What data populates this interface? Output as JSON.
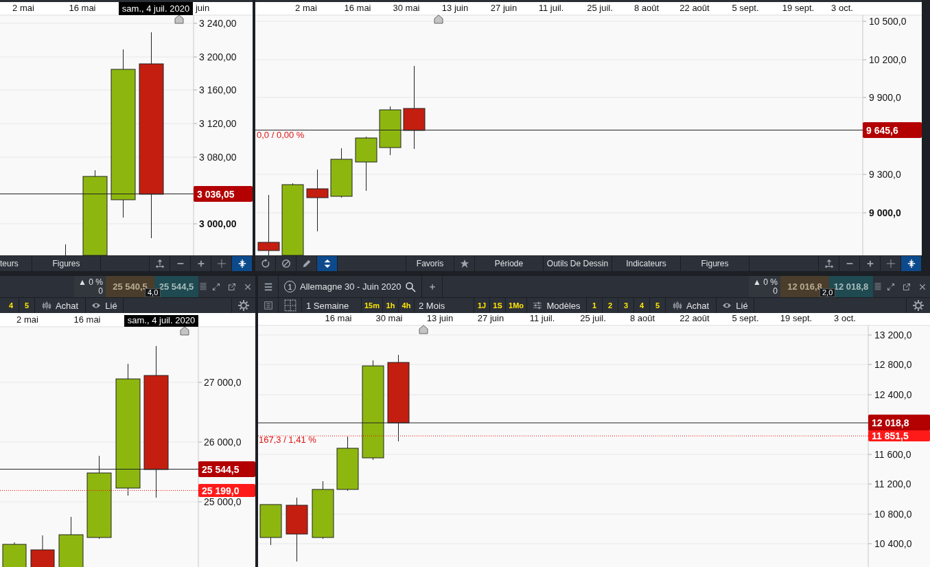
{
  "panels": [
    {
      "time_axis": [
        "2 mai",
        "16 mai",
        "juin"
      ],
      "cursor_date": "sam., 4 juil. 2020",
      "price_axis": [
        {
          "label": "3 240,00",
          "bold": false
        },
        {
          "label": "3 200,00",
          "bold": false
        },
        {
          "label": "3 160,00",
          "bold": false
        },
        {
          "label": "3 120,00",
          "bold": false
        },
        {
          "label": "3 080,00",
          "bold": false
        },
        {
          "label": "3 000,00",
          "bold": true
        }
      ],
      "price_tags": [
        {
          "label": "3 036,05",
          "kind": "last"
        }
      ],
      "toolbar": [
        {
          "kind": "menu",
          "label": "teurs"
        },
        {
          "kind": "menu",
          "label": "Figures"
        },
        {
          "kind": "tool",
          "selected": false
        },
        {
          "kind": "tool",
          "selected": false
        },
        {
          "kind": "tool",
          "selected": false
        },
        {
          "kind": "tool",
          "selected": false
        },
        {
          "kind": "tool",
          "selected": true
        }
      ]
    },
    {
      "time_axis": [
        "2 mai",
        "16 mai",
        "30 mai",
        "13 juin",
        "27 juin",
        "11 juil.",
        "25 juil.",
        "8 août",
        "22 août",
        "5 sept.",
        "19 sept.",
        "3 oct."
      ],
      "price_axis": [
        {
          "label": "10 500,0",
          "bold": false
        },
        {
          "label": "10 200,0",
          "bold": false
        },
        {
          "label": "9 900,0",
          "bold": false
        },
        {
          "label": "9 300,0",
          "bold": false
        },
        {
          "label": "9 000,0",
          "bold": true
        }
      ],
      "price_tags": [
        {
          "label": "9 645,6",
          "kind": "last"
        }
      ],
      "change_label": "0,0 / 0,00 %",
      "toolbar": [
        {
          "kind": "tool",
          "selected": false
        },
        {
          "kind": "tool",
          "selected": false
        },
        {
          "kind": "tool",
          "selected": false
        },
        {
          "kind": "tool",
          "selected": true
        },
        {
          "kind": "menu",
          "label": "Favoris"
        },
        {
          "kind": "star"
        },
        {
          "kind": "menu",
          "label": "Période"
        },
        {
          "kind": "menu",
          "label": "Outils De Dessin"
        },
        {
          "kind": "menu",
          "label": "Indicateurs"
        },
        {
          "kind": "menu",
          "label": "Figures"
        },
        {
          "kind": "tool",
          "selected": false
        },
        {
          "kind": "tool",
          "selected": false
        },
        {
          "kind": "tool",
          "selected": false
        },
        {
          "kind": "tool",
          "selected": false
        },
        {
          "kind": "tool",
          "selected": true
        }
      ]
    },
    {
      "header": {
        "change": "▲ 0 %",
        "change_points": "0",
        "bid": "25 540,5",
        "ask": "25 544,5",
        "spread": "4,0",
        "buttons": [
          {
            "kind": "quick",
            "label": "4"
          },
          {
            "kind": "quick",
            "label": "5"
          },
          {
            "kind": "order",
            "label": "Achat"
          },
          {
            "kind": "link",
            "label": "Lié"
          }
        ]
      },
      "time_axis": [
        "2 mai",
        "16 mai"
      ],
      "cursor_date": "sam., 4 juil. 2020",
      "price_axis": [
        {
          "label": "27 000,0",
          "bold": false
        },
        {
          "label": "26 000,0",
          "bold": false
        },
        {
          "label": "25 000,0",
          "bold": false
        }
      ],
      "price_tags": [
        {
          "label": "25 544,5",
          "kind": "last"
        },
        {
          "label": "25 199,0",
          "kind": "alert"
        }
      ]
    },
    {
      "header": {
        "badge": "1",
        "title": "Allemagne 30 - Juin 2020",
        "change": "▲ 0 %",
        "change_points": "0",
        "bid": "12 016,8",
        "ask": "12 018,8",
        "spread": "2,0",
        "buttons": [
          {
            "kind": "list"
          },
          {
            "kind": "layout"
          },
          {
            "kind": "period",
            "label": "1 Semaine"
          },
          {
            "kind": "quick",
            "label": "15m"
          },
          {
            "kind": "quick",
            "label": "1h"
          },
          {
            "kind": "quick",
            "label": "4h"
          },
          {
            "kind": "period",
            "label": "2 Mois"
          },
          {
            "kind": "quick",
            "label": "1J"
          },
          {
            "kind": "quick",
            "label": "1S"
          },
          {
            "kind": "quick",
            "label": "1Mo"
          },
          {
            "kind": "models",
            "label": "Modèles"
          },
          {
            "kind": "quick",
            "label": "1"
          },
          {
            "kind": "quick",
            "label": "2"
          },
          {
            "kind": "quick",
            "label": "3"
          },
          {
            "kind": "quick",
            "label": "4"
          },
          {
            "kind": "quick",
            "label": "5"
          },
          {
            "kind": "order",
            "label": "Achat"
          },
          {
            "kind": "link",
            "label": "Lié"
          }
        ]
      },
      "time_axis": [
        "16 mai",
        "30 mai",
        "13 juin",
        "27 juin",
        "11 juil.",
        "25 juil.",
        "8 août",
        "22 août",
        "5 sept.",
        "19 sept.",
        "3 oct."
      ],
      "price_axis": [
        {
          "label": "13 200,0",
          "bold": false
        },
        {
          "label": "12 800,0",
          "bold": false
        },
        {
          "label": "12 400,0",
          "bold": false
        },
        {
          "label": "11 600,0",
          "bold": false
        },
        {
          "label": "11 200,0",
          "bold": false
        },
        {
          "label": "10 800,0",
          "bold": false
        },
        {
          "label": "10 400,0",
          "bold": false
        }
      ],
      "price_tags": [
        {
          "label": "12 018,8",
          "kind": "last"
        },
        {
          "label": "11 851,5",
          "kind": "alert"
        }
      ],
      "change_label": "167,3 / 1,41 %"
    }
  ]
}
